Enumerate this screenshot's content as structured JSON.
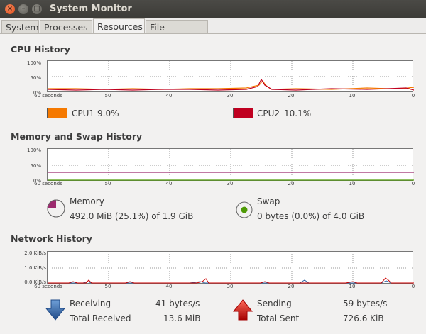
{
  "window": {
    "title": "System Monitor"
  },
  "tabs": [
    "System",
    "Processes",
    "Resources",
    "File Systems"
  ],
  "active_tab": "Resources",
  "cpu": {
    "title": "CPU History",
    "y_ticks": [
      "100%",
      "50%",
      "0%"
    ],
    "cpu1": {
      "label": "CPU1",
      "value": "9.0%",
      "color": "#f57900"
    },
    "cpu2": {
      "label": "CPU2",
      "value": "10.1%",
      "color": "#c00020"
    }
  },
  "x_ticks": [
    "60 seconds",
    "50",
    "40",
    "30",
    "20",
    "10",
    "0"
  ],
  "memory": {
    "title": "Memory and Swap History",
    "y_ticks": [
      "100%",
      "50%",
      "0%"
    ],
    "memory_label": "Memory",
    "memory_detail": "492.0 MiB (25.1%) of 1.9 GiB",
    "memory_color": "#9c2a6e",
    "swap_label": "Swap",
    "swap_detail": "0 bytes (0.0%) of 4.0 GiB",
    "swap_color": "#4e9a06"
  },
  "network": {
    "title": "Network History",
    "y_ticks": [
      "2.0 KiB/s",
      "1.0 KiB/s",
      "0.0 KiB/s"
    ],
    "receiving_label": "Receiving",
    "receiving_value": "41 bytes/s",
    "total_received_label": "Total Received",
    "total_received_value": "13.6 MiB",
    "sending_label": "Sending",
    "sending_value": "59 bytes/s",
    "total_sent_label": "Total Sent",
    "total_sent_value": "726.6 KiB",
    "receiving_color": "#3465a4",
    "sending_color": "#cc0000"
  }
}
